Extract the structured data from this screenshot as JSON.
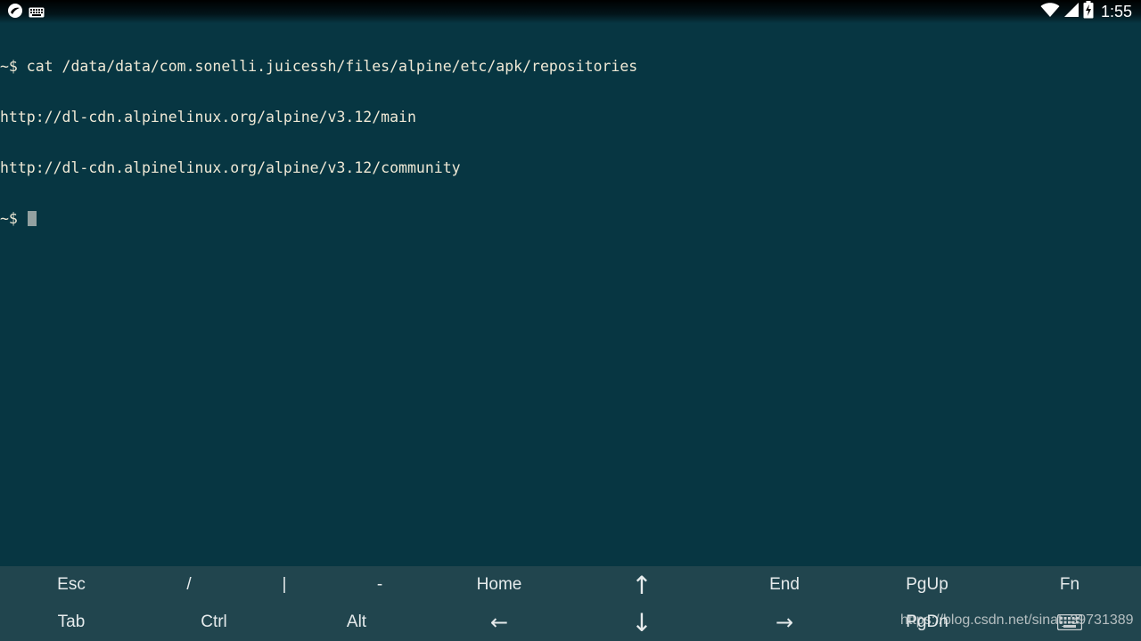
{
  "status_bar": {
    "left_icons": [
      "juicessh-app-icon",
      "keyboard-icon"
    ],
    "right_icons": [
      "wifi-icon",
      "cell-signal-icon",
      "battery-charging-icon"
    ],
    "time": "1:55"
  },
  "terminal": {
    "lines": [
      "~$ cat /data/data/com.sonelli.juicessh/files/alpine/etc/apk/repositories",
      "http://dl-cdn.alpinelinux.org/alpine/v3.12/main",
      "http://dl-cdn.alpinelinux.org/alpine/v3.12/community"
    ],
    "prompt": "~$ "
  },
  "extra_keys": {
    "row1": [
      "Esc",
      "/",
      "|",
      "-",
      "Home",
      "↑",
      "End",
      "PgUp",
      "Fn"
    ],
    "row2": [
      "Tab",
      "Ctrl",
      "Alt",
      "←",
      "↓",
      "→",
      "PgDn"
    ]
  },
  "watermark": "https://blog.csdn.net/sinat_39731389",
  "colors": {
    "terminal_bg": "#073642",
    "terminal_fg": "#eee8d5",
    "keybar_bg": "#21454e",
    "cursor": "#93a1a1"
  }
}
